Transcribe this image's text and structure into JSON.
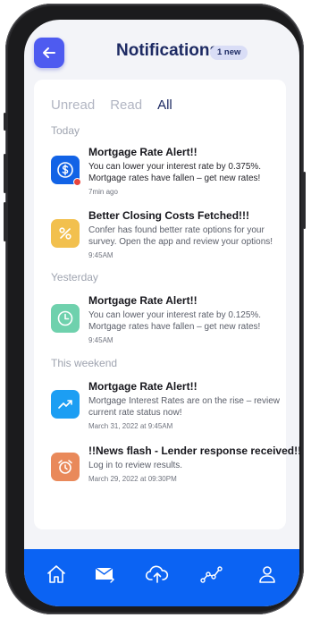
{
  "header": {
    "title": "Notifications",
    "badge": "1 new",
    "back_icon": "arrow-left-icon"
  },
  "tabs": [
    {
      "label": "Unread",
      "active": false
    },
    {
      "label": "Read",
      "active": false
    },
    {
      "label": "All",
      "active": true
    }
  ],
  "sections": {
    "today": "Today",
    "yesterday": "Yesterday",
    "weekend": "This weekend"
  },
  "notifications": [
    {
      "title": "Mortgage Rate Alert!!",
      "body": "You can lower your interest rate by 0.375%. Mortgage rates have fallen – get new rates!",
      "time": "7min ago",
      "icon": "dollar-circle-icon",
      "icon_color": "#1263e6",
      "unread_dot": true
    },
    {
      "title": "Better Closing Costs Fetched!!!",
      "body": "Confer has found better rate options for your survey. Open the app and review your options!",
      "time": "9:45AM",
      "icon": "percent-icon",
      "icon_color": "#f2c04e",
      "unread_dot": false
    },
    {
      "title": "Mortgage Rate Alert!!",
      "body": "You can lower your interest rate by 0.125%. Mortgage rates have fallen – get new rates!",
      "time": "9:45AM",
      "icon": "clock-icon",
      "icon_color": "#6fd1ad",
      "unread_dot": false
    },
    {
      "title": "Mortgage Rate Alert!!",
      "body": "Mortgage Interest Rates are on the rise – review current rate status now!",
      "time": "March  31, 2022 at 9:45AM",
      "icon": "trend-up-icon",
      "icon_color": "#1c9ef3",
      "unread_dot": false
    },
    {
      "title": "!!News flash - Lender response received!!",
      "body": "Log in to review results.",
      "time": "March 29, 2022 at 09:30PM",
      "icon": "alarm-icon",
      "icon_color": "#e9895a",
      "unread_dot": false
    }
  ],
  "navbar": {
    "color": "#0b63f3",
    "items": [
      "home-icon",
      "mail-icon",
      "cloud-upload-icon",
      "chart-line-icon",
      "user-icon"
    ]
  }
}
